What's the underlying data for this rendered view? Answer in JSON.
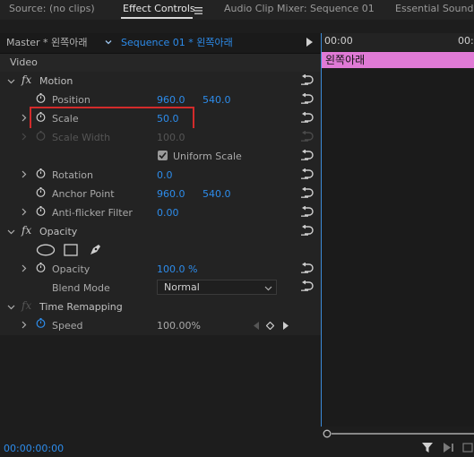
{
  "tabs": {
    "source": "Source: (no clips)",
    "effect_controls": "Effect Controls",
    "audio_mixer": "Audio Clip Mixer: Sequence 01",
    "essential_sound": "Essential Sound"
  },
  "header": {
    "master": "Master * 왼쪽아래",
    "sequence": "Sequence 01 * 왼쪽아래"
  },
  "timeline": {
    "time_left": "00:00",
    "time_right": "00:0",
    "clip_label": "왼쪽아래"
  },
  "section_video": "Video",
  "motion": {
    "label": "Motion",
    "position": {
      "label": "Position",
      "x": "960.0",
      "y": "540.0"
    },
    "scale": {
      "label": "Scale",
      "value": "50.0"
    },
    "scale_width": {
      "label": "Scale Width",
      "value": "100.0"
    },
    "uniform_scale": {
      "label": "Uniform Scale",
      "checked": true
    },
    "rotation": {
      "label": "Rotation",
      "value": "0.0"
    },
    "anchor_point": {
      "label": "Anchor Point",
      "x": "960.0",
      "y": "540.0"
    },
    "anti_flicker": {
      "label": "Anti-flicker Filter",
      "value": "0.00"
    }
  },
  "opacity": {
    "label": "Opacity",
    "opacity": {
      "label": "Opacity",
      "value": "100.0 %"
    },
    "blend_mode": {
      "label": "Blend Mode",
      "value": "Normal"
    }
  },
  "time_remapping": {
    "label": "Time Remapping",
    "speed": {
      "label": "Speed",
      "value": "100.00%"
    }
  },
  "footer": {
    "timecode": "00:00:00:00"
  },
  "colors": {
    "accent_blue": "#2d8ceb",
    "clip_pink": "#e07ad6",
    "highlight_red": "#d32b2b"
  }
}
